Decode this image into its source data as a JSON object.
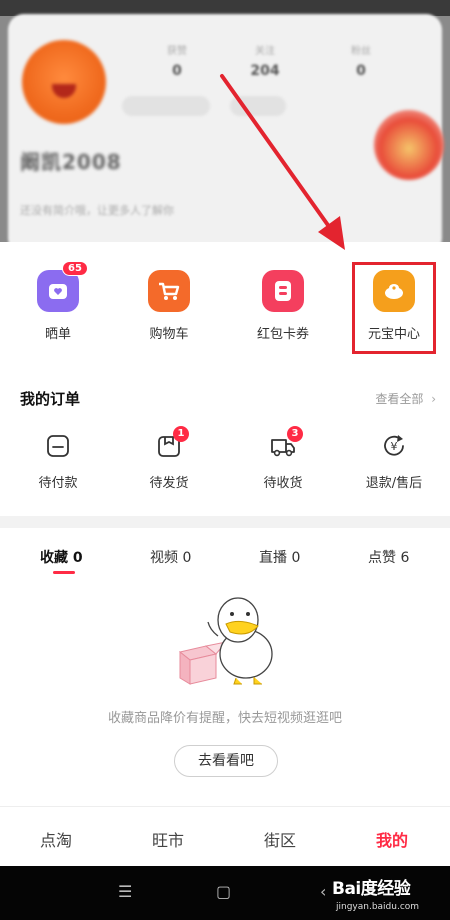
{
  "profile": {
    "stats": [
      {
        "label": "获赞",
        "value": "0"
      },
      {
        "label": "关注",
        "value": "204"
      },
      {
        "label": "粉丝",
        "value": "0"
      }
    ],
    "nickname": "阚凯2008",
    "bio": "还没有简介哦，让更多人了解你"
  },
  "services": [
    {
      "label": "晒单",
      "badge": "65",
      "color": "#8b6cf0"
    },
    {
      "label": "购物车",
      "color": "#f46a2a"
    },
    {
      "label": "红包卡券",
      "color": "#f43f5e"
    },
    {
      "label": "元宝中心",
      "color": "#f59f1c"
    }
  ],
  "orders": {
    "title": "我的订单",
    "view_all": "查看全部",
    "items": [
      {
        "label": "待付款",
        "icon": "wallet-icon"
      },
      {
        "label": "待发货",
        "icon": "package-icon",
        "badge": "1"
      },
      {
        "label": "待收货",
        "icon": "truck-icon",
        "badge": "3"
      },
      {
        "label": "退款/售后",
        "icon": "refund-icon"
      }
    ]
  },
  "tabs": [
    {
      "label": "收藏 0"
    },
    {
      "label": "视频 0"
    },
    {
      "label": "直播 0"
    },
    {
      "label": "点赞 6"
    }
  ],
  "empty": {
    "text": "收藏商品降价有提醒，快去短视频逛逛吧",
    "button": "去看看吧"
  },
  "bottom_nav": [
    {
      "label": "点淘"
    },
    {
      "label": "旺市"
    },
    {
      "label": "街区"
    },
    {
      "label": "我的"
    }
  ],
  "watermark": {
    "main": "Bai度经验",
    "sub": "jingyan.baidu.com"
  },
  "colors": {
    "accent": "#ff2b45",
    "highlight_box": "#e3242f"
  }
}
